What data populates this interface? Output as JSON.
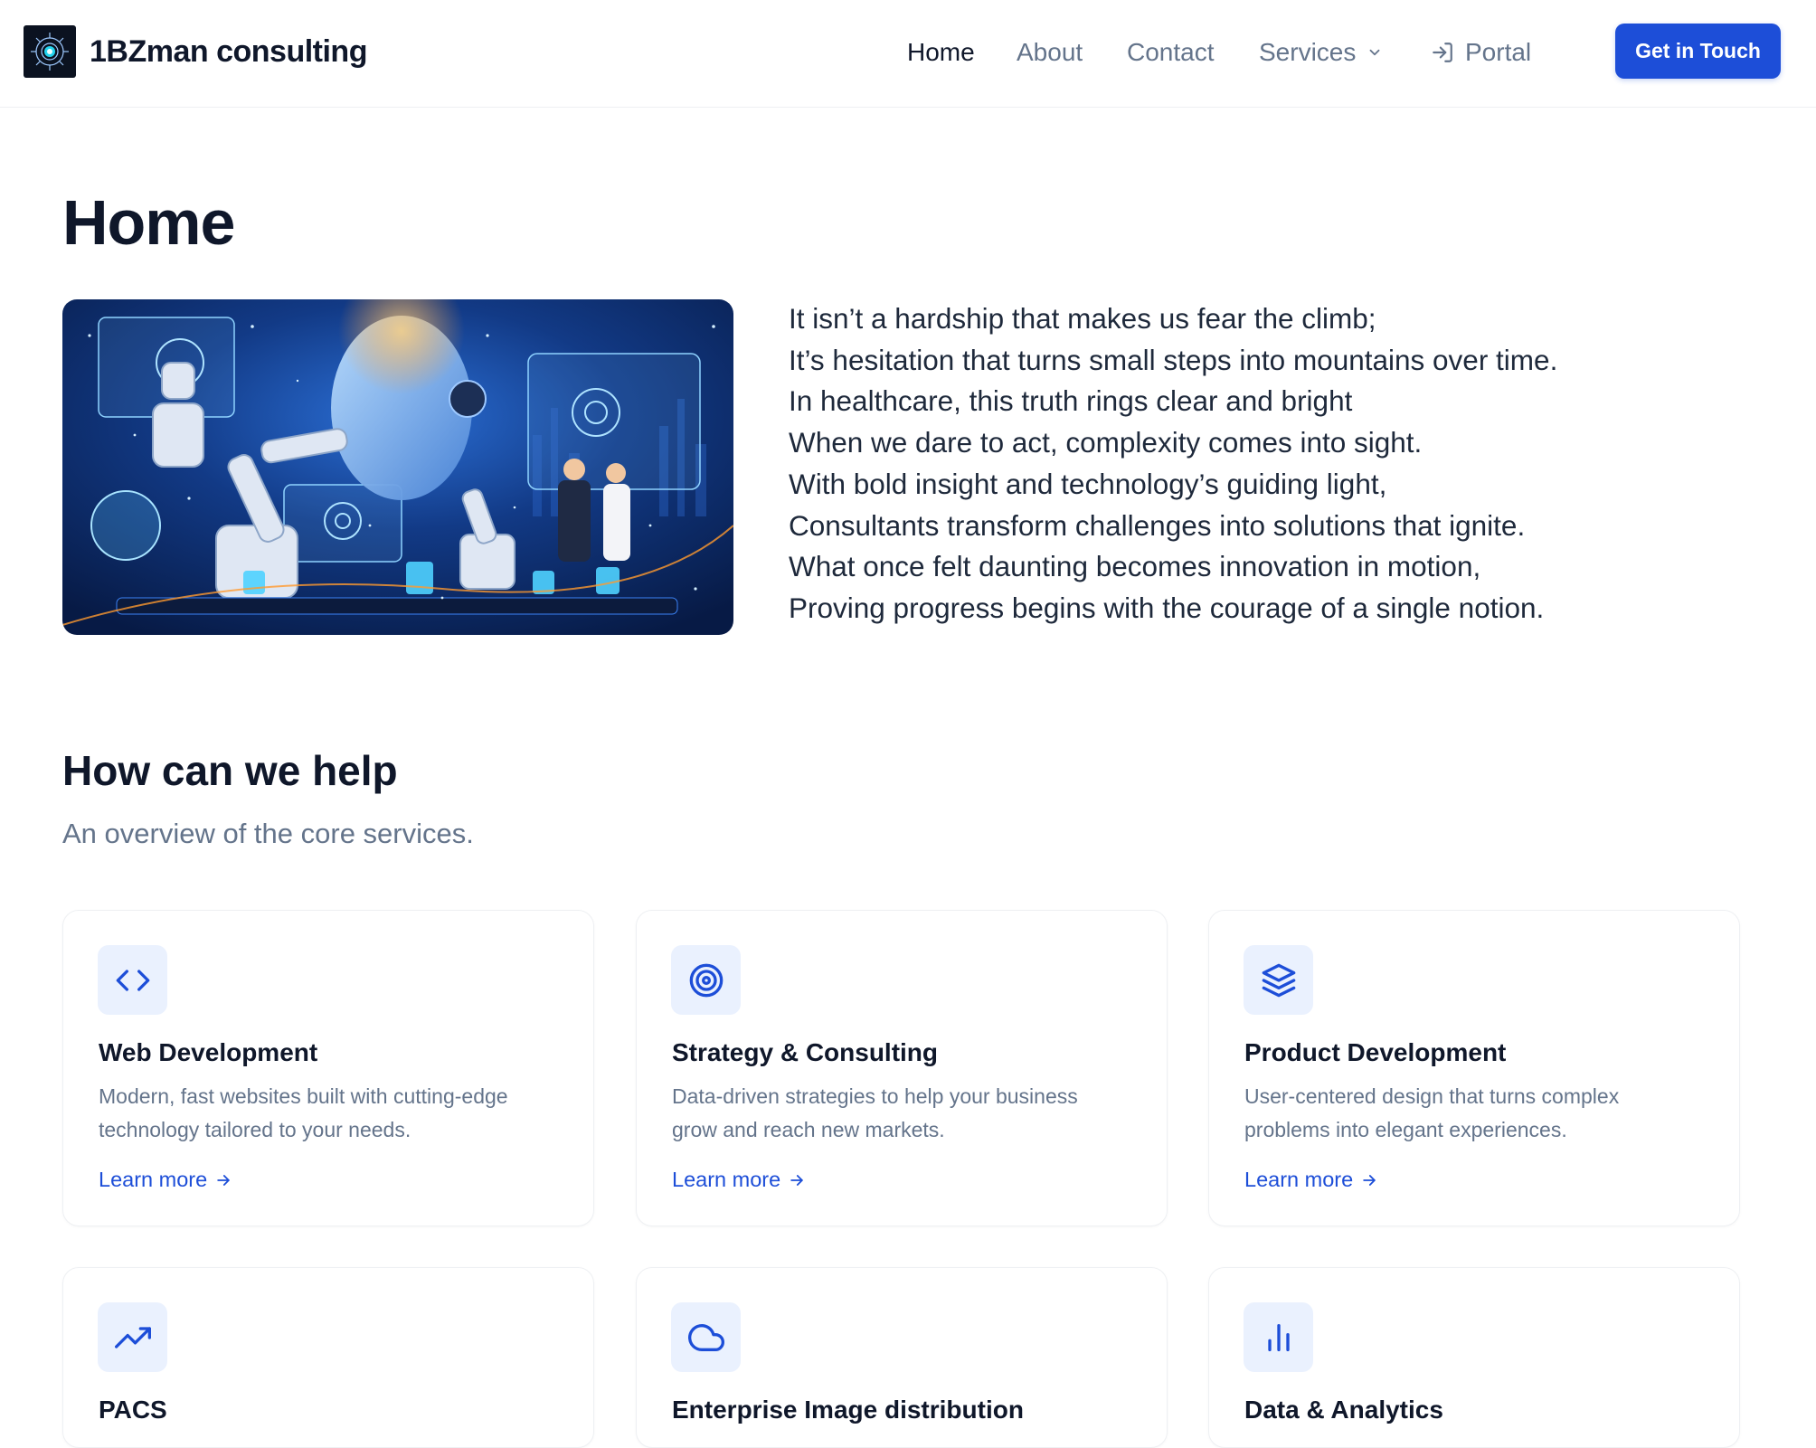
{
  "header": {
    "brand_name": "1BZman consulting",
    "nav": {
      "home": "Home",
      "about": "About",
      "contact": "Contact",
      "services": "Services",
      "portal": "Portal"
    },
    "cta_label": "Get in Touch"
  },
  "hero": {
    "title": "Home",
    "poem": [
      "It isn’t a hardship that makes us fear the climb;",
      "It’s hesitation that turns small steps into mountains over time.",
      "In healthcare, this truth rings clear and bright",
      "When we dare to act, complexity comes into sight.",
      "With bold insight and technology’s guiding light,",
      "Consultants transform challenges into solutions that ignite.",
      "What once felt daunting becomes innovation in motion,",
      "Proving progress begins with the courage of a single notion."
    ]
  },
  "services": {
    "title": "How can we help",
    "subtitle": "An overview of the core services.",
    "cards": [
      {
        "icon": "code-icon",
        "title": "Web Development",
        "desc_lines": [
          "Modern, fast websites built with cutting-edge",
          "technology tailored to your needs."
        ],
        "link": "Learn more"
      },
      {
        "icon": "target-icon",
        "title": "Strategy & Consulting",
        "desc_lines": [
          "Data-driven strategies to help your business",
          "grow and reach new markets."
        ],
        "link": "Learn more"
      },
      {
        "icon": "layers-icon",
        "title": "Product Development",
        "desc_lines": [
          "User-centered design that turns complex",
          "problems into elegant experiences."
        ],
        "link": "Learn more"
      },
      {
        "icon": "trending-up-icon",
        "title": "PACS"
      },
      {
        "icon": "cloud-icon",
        "title": "Enterprise Image distribution"
      },
      {
        "icon": "bar-chart-icon",
        "title": "Data & Analytics"
      }
    ]
  },
  "colors": {
    "accent": "#1d4ed8",
    "icon_bg": "#eaf1fe",
    "muted_text": "#64748b",
    "heading": "#0f172a"
  }
}
